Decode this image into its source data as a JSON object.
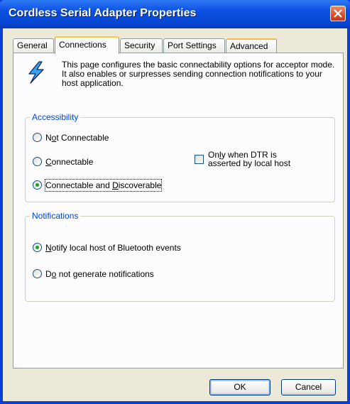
{
  "window": {
    "title": "Cordless Serial Adapter Properties"
  },
  "tabs": [
    {
      "label": "General"
    },
    {
      "label": "Connections",
      "active": true
    },
    {
      "label": "Security"
    },
    {
      "label": "Port Settings"
    },
    {
      "label": "Advanced"
    }
  ],
  "info": {
    "icon": "lightning-bolt-icon",
    "text": "This page configures the basic connectability options for acceptor mode. It also enables or surpresses sending connection notifications to your host application."
  },
  "accessibility": {
    "title": "Accessibility",
    "options": [
      {
        "pre": "N",
        "u": "o",
        "post": "t Connectable",
        "selected": false
      },
      {
        "pre": "",
        "u": "C",
        "post": "onnectable",
        "selected": false
      },
      {
        "pre": "Connectable and ",
        "u": "D",
        "post": "iscoverable",
        "selected": true
      }
    ],
    "dtr": {
      "pre": "On",
      "u": "l",
      "post": "y when DTR is",
      "line2": "asserted by local host",
      "checked": false
    }
  },
  "notifications": {
    "title": "Notifications",
    "options": [
      {
        "pre": "",
        "u": "N",
        "post": "otify local host of Bluetooth events",
        "selected": true
      },
      {
        "pre": "D",
        "u": "o",
        "post": " not generate notifications",
        "selected": false
      }
    ]
  },
  "buttons": {
    "ok": "OK",
    "cancel": "Cancel"
  },
  "colors": {
    "title_bar": "#0a4ee0",
    "face": "#ece9d8",
    "group_title": "#0046d5",
    "radio_dot": "#21a121"
  }
}
